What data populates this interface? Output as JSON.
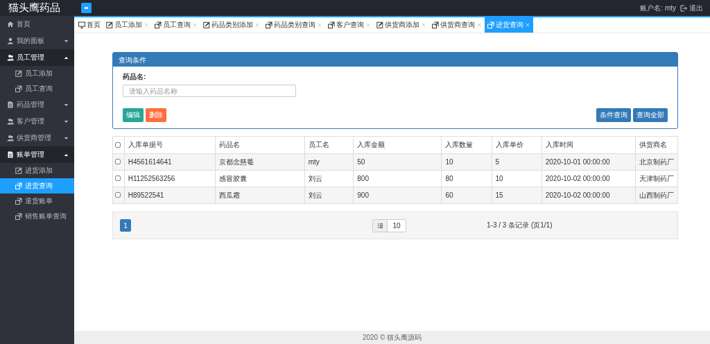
{
  "header": {
    "logo": "猫头鹰药品",
    "account_label": "账户名:",
    "account_name": "mty",
    "logout": "退出"
  },
  "sidebar": {
    "items": [
      {
        "label": "首页",
        "kind": "link",
        "selected": false
      },
      {
        "label": "我的面板",
        "kind": "group",
        "expanded": false,
        "selected": false
      },
      {
        "label": "员工管理",
        "kind": "group",
        "expanded": true,
        "selected": false,
        "children": [
          {
            "label": "员工添加",
            "selected": false
          },
          {
            "label": "员工查询",
            "selected": false
          }
        ]
      },
      {
        "label": "药品管理",
        "kind": "group",
        "expanded": false,
        "selected": false
      },
      {
        "label": "客户管理",
        "kind": "group",
        "expanded": false,
        "selected": false
      },
      {
        "label": "供货商管理",
        "kind": "group",
        "expanded": false,
        "selected": false
      },
      {
        "label": "账单管理",
        "kind": "group",
        "expanded": true,
        "selected": false,
        "children": [
          {
            "label": "进货添加",
            "selected": false
          },
          {
            "label": "进货查询",
            "selected": true
          },
          {
            "label": "退货账单",
            "selected": false
          },
          {
            "label": "销售账单查询",
            "selected": false
          }
        ]
      }
    ]
  },
  "tabs": [
    {
      "label": "首页",
      "selected": false,
      "closable": false
    },
    {
      "label": "员工添加",
      "selected": false,
      "closable": true
    },
    {
      "label": "员工查询",
      "selected": false,
      "closable": true
    },
    {
      "label": "药品类别添加",
      "selected": false,
      "closable": true
    },
    {
      "label": "药品类别查询",
      "selected": false,
      "closable": true
    },
    {
      "label": "客户查询",
      "selected": false,
      "closable": true
    },
    {
      "label": "供货商添加",
      "selected": false,
      "closable": true
    },
    {
      "label": "供货商查询",
      "selected": false,
      "closable": true
    },
    {
      "label": "进货查询",
      "selected": true,
      "closable": true
    }
  ],
  "query_panel": {
    "title": "查询条件",
    "field_label": "药品名:",
    "placeholder": "请输入药品名称",
    "buttons": [
      {
        "label": "编辑",
        "kind": "success"
      },
      {
        "label": "删除",
        "kind": "danger"
      },
      {
        "label": "条件查询",
        "kind": "primary"
      },
      {
        "label": "查询全部",
        "kind": "primary"
      }
    ]
  },
  "table": {
    "select_all": false,
    "columns": [
      "入库单据号",
      "药品名",
      "员工名",
      "入库金额",
      "入库数量",
      "入库单价",
      "入库时间",
      "供货商名"
    ],
    "rows": [
      {
        "checked": false,
        "cells": [
          "H4561614641",
          "京都念慈菴",
          "mty",
          "50",
          "10",
          "5",
          "2020-10-01 00:00:00",
          "北京制药厂"
        ]
      },
      {
        "checked": false,
        "cells": [
          "H11252563256",
          "感冒胶囊",
          "刘云",
          "800",
          "80",
          "10",
          "2020-10-02 00:00:00",
          "天津制药厂"
        ]
      },
      {
        "checked": false,
        "cells": [
          "H89522541",
          "西瓜霜",
          "刘云",
          "900",
          "60",
          "15",
          "2020-10-02 00:00:00",
          "山西制药厂"
        ]
      }
    ]
  },
  "pagination": {
    "pages": [
      {
        "label": "1",
        "selected": true
      }
    ],
    "page_size": "10",
    "summary": "1-3 / 3 条记录 (页1/1)"
  },
  "footer": "2020 © 猫头鹰源码"
}
